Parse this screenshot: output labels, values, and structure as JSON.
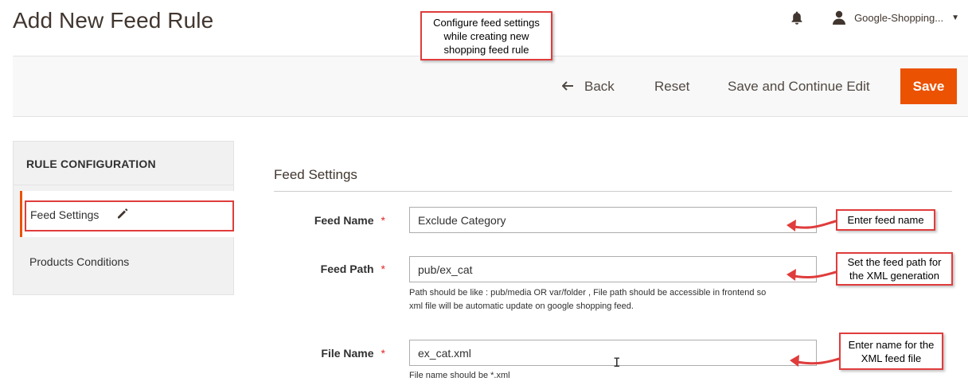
{
  "page": {
    "title": "Add New Feed Rule"
  },
  "header": {
    "user_name": "Google-Shopping...",
    "notification_icon": "bell-icon",
    "user_icon": "user-icon"
  },
  "toolbar": {
    "back_label": "Back",
    "reset_label": "Reset",
    "save_continue_label": "Save and Continue Edit",
    "save_label": "Save",
    "accent_color": "#eb5202"
  },
  "sidebar": {
    "title": "RULE CONFIGURATION",
    "items": [
      {
        "label": "Feed Settings",
        "active": true,
        "icon": "pencil-icon"
      },
      {
        "label": "Products Conditions",
        "active": false
      }
    ]
  },
  "section": {
    "title": "Feed Settings"
  },
  "form": {
    "feed_name": {
      "label": "Feed Name",
      "value": "Exclude Category",
      "required_mark": "*"
    },
    "feed_path": {
      "label": "Feed Path",
      "value": "pub/ex_cat",
      "required_mark": "*",
      "note_line1": "Path should be like : pub/media OR var/folder , File path should be accessible in frontend so",
      "note_line2": "xml file will be automatic update on google shopping feed."
    },
    "file_name": {
      "label": "File Name",
      "value": "ex_cat.xml",
      "required_mark": "*",
      "note": "File name should be *.xml"
    }
  },
  "callouts": {
    "top": [
      "Configure feed settings",
      "while creating new",
      "shopping feed rule"
    ],
    "feed_name": [
      "Enter feed name"
    ],
    "feed_path": [
      "Set the feed path for",
      "the XML generation"
    ],
    "file_name": [
      "Enter name for the",
      "XML feed file"
    ]
  },
  "colors": {
    "callout_border": "#e03c3c",
    "required": "#e22626"
  }
}
